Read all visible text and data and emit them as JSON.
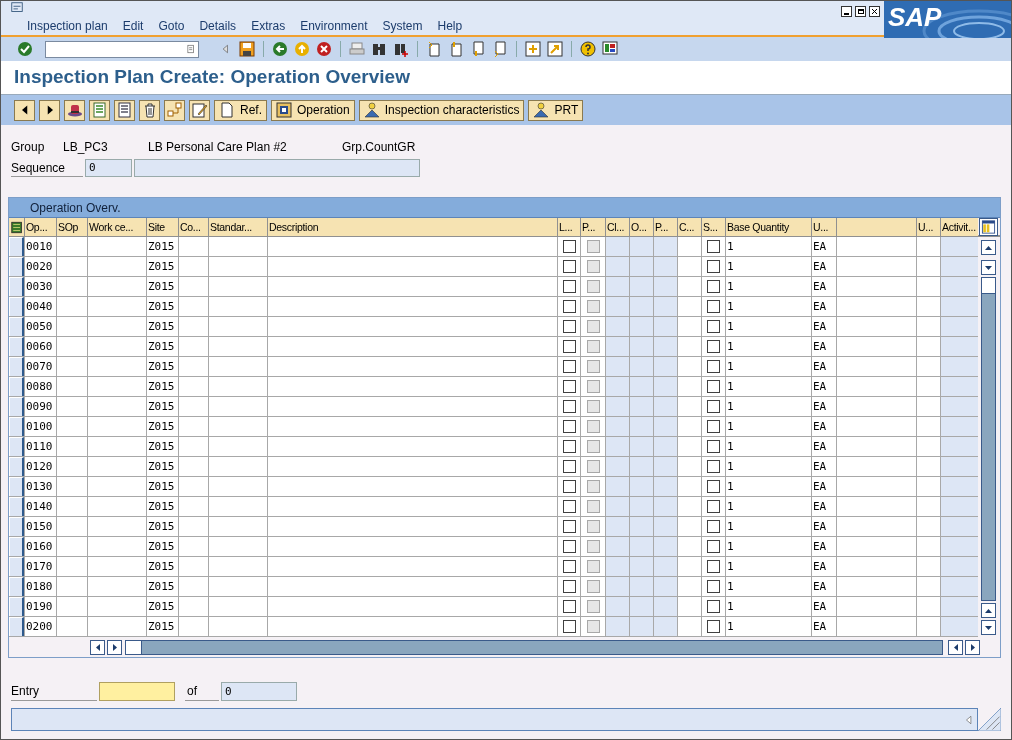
{
  "menu": [
    "Inspection plan",
    "Edit",
    "Goto",
    "Details",
    "Extras",
    "Environment",
    "System",
    "Help"
  ],
  "logo": "SAP",
  "title": "Inspection Plan Create: Operation Overview",
  "app_toolbar": [
    {
      "kind": "icon"
    },
    {
      "kind": "icon"
    },
    {
      "kind": "icon"
    },
    {
      "kind": "icon"
    },
    {
      "kind": "icon"
    },
    {
      "kind": "icon"
    },
    {
      "kind": "icon"
    },
    {
      "kind": "icon"
    },
    {
      "kind": "text",
      "label": "Ref."
    },
    {
      "kind": "text",
      "label": "Operation"
    },
    {
      "kind": "text",
      "label": "Inspection characteristics"
    },
    {
      "kind": "text",
      "label": "PRT"
    }
  ],
  "header": {
    "group_label": "Group",
    "group_value": "LB_PC3",
    "group_description": "LB Personal Care Plan #2",
    "count_label": "Grp.CountGR",
    "sequence_label": "Sequence",
    "sequence_value": "0"
  },
  "table": {
    "title": "Operation Overv.",
    "columns": [
      {
        "label": "Op...",
        "kind": "text",
        "shaded": false
      },
      {
        "label": "SOp",
        "kind": "text",
        "shaded": false
      },
      {
        "label": "Work ce...",
        "kind": "text",
        "shaded": false
      },
      {
        "label": "Site",
        "kind": "text",
        "shaded": false
      },
      {
        "label": "Co...",
        "kind": "text",
        "shaded": false
      },
      {
        "label": "Standar...",
        "kind": "text",
        "shaded": false
      },
      {
        "label": "Description",
        "kind": "text",
        "shaded": false
      },
      {
        "label": "L...",
        "kind": "checkbox",
        "disabled": false,
        "shaded": false
      },
      {
        "label": "P...",
        "kind": "checkbox",
        "disabled": true,
        "shaded": false
      },
      {
        "label": "Cl...",
        "kind": "text",
        "shaded": true
      },
      {
        "label": "O...",
        "kind": "text",
        "shaded": true
      },
      {
        "label": "P...",
        "kind": "text",
        "shaded": true
      },
      {
        "label": "C...",
        "kind": "text",
        "shaded": false
      },
      {
        "label": "S...",
        "kind": "checkbox",
        "disabled": false,
        "shaded": false
      },
      {
        "label": "Base Quantity",
        "kind": "text",
        "shaded": false
      },
      {
        "label": "U...",
        "kind": "text",
        "shaded": false
      },
      {
        "kind": "text",
        "shaded": false
      },
      {
        "label": "U...",
        "kind": "text",
        "shaded": false
      },
      {
        "label": "Activit...",
        "kind": "text",
        "shaded": true
      }
    ],
    "rows": [
      {
        "op": "0010",
        "site": "Z015",
        "l": false,
        "p": false,
        "s": false,
        "base_quantity": "1",
        "unit": "EA"
      },
      {
        "op": "0020",
        "site": "Z015",
        "l": false,
        "p": false,
        "s": false,
        "base_quantity": "1",
        "unit": "EA"
      },
      {
        "op": "0030",
        "site": "Z015",
        "l": false,
        "p": false,
        "s": false,
        "base_quantity": "1",
        "unit": "EA"
      },
      {
        "op": "0040",
        "site": "Z015",
        "l": false,
        "p": false,
        "s": false,
        "base_quantity": "1",
        "unit": "EA"
      },
      {
        "op": "0050",
        "site": "Z015",
        "l": false,
        "p": false,
        "s": false,
        "base_quantity": "1",
        "unit": "EA"
      },
      {
        "op": "0060",
        "site": "Z015",
        "l": false,
        "p": false,
        "s": false,
        "base_quantity": "1",
        "unit": "EA"
      },
      {
        "op": "0070",
        "site": "Z015",
        "l": false,
        "p": false,
        "s": false,
        "base_quantity": "1",
        "unit": "EA"
      },
      {
        "op": "0080",
        "site": "Z015",
        "l": false,
        "p": false,
        "s": false,
        "base_quantity": "1",
        "unit": "EA"
      },
      {
        "op": "0090",
        "site": "Z015",
        "l": false,
        "p": false,
        "s": false,
        "base_quantity": "1",
        "unit": "EA"
      },
      {
        "op": "0100",
        "site": "Z015",
        "l": false,
        "p": false,
        "s": false,
        "base_quantity": "1",
        "unit": "EA"
      },
      {
        "op": "0110",
        "site": "Z015",
        "l": false,
        "p": false,
        "s": false,
        "base_quantity": "1",
        "unit": "EA"
      },
      {
        "op": "0120",
        "site": "Z015",
        "l": false,
        "p": false,
        "s": false,
        "base_quantity": "1",
        "unit": "EA"
      },
      {
        "op": "0130",
        "site": "Z015",
        "l": false,
        "p": false,
        "s": false,
        "base_quantity": "1",
        "unit": "EA"
      },
      {
        "op": "0140",
        "site": "Z015",
        "l": false,
        "p": false,
        "s": false,
        "base_quantity": "1",
        "unit": "EA"
      },
      {
        "op": "0150",
        "site": "Z015",
        "l": false,
        "p": false,
        "s": false,
        "base_quantity": "1",
        "unit": "EA"
      },
      {
        "op": "0160",
        "site": "Z015",
        "l": false,
        "p": false,
        "s": false,
        "base_quantity": "1",
        "unit": "EA"
      },
      {
        "op": "0170",
        "site": "Z015",
        "l": false,
        "p": false,
        "s": false,
        "base_quantity": "1",
        "unit": "EA"
      },
      {
        "op": "0180",
        "site": "Z015",
        "l": false,
        "p": false,
        "s": false,
        "base_quantity": "1",
        "unit": "EA"
      },
      {
        "op": "0190",
        "site": "Z015",
        "l": false,
        "p": false,
        "s": false,
        "base_quantity": "1",
        "unit": "EA"
      },
      {
        "op": "0200",
        "site": "Z015",
        "l": false,
        "p": false,
        "s": false,
        "base_quantity": "1",
        "unit": "EA"
      }
    ]
  },
  "footer": {
    "entry_label": "Entry",
    "of_label": "of",
    "total_value": "0"
  }
}
